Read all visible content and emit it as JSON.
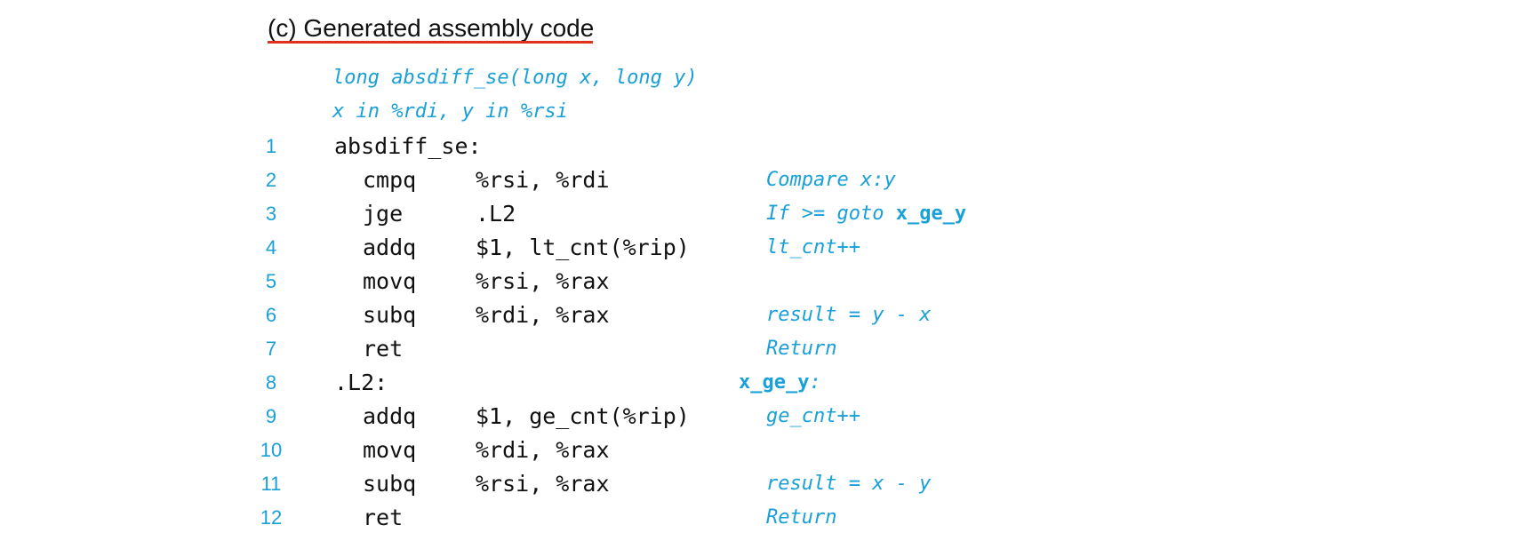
{
  "caption": "(c) Generated assembly code",
  "signature": {
    "line1": "long absdiff_se(long x, long y)",
    "line2": "x in %rdi, y in %rsi"
  },
  "colors": {
    "accent": "#1aa0d8",
    "underline": "#e0301e",
    "text": "#111111"
  },
  "lines": [
    {
      "num": "1",
      "label": "absdiff_se:",
      "op": "",
      "args": "",
      "comment": ""
    },
    {
      "num": "2",
      "label": "",
      "op": "cmpq",
      "args": "%rsi, %rdi",
      "comment": "Compare x:y"
    },
    {
      "num": "3",
      "label": "",
      "op": "jge",
      "args": ".L2",
      "comment": "If >= goto ",
      "comment_bold": "x_ge_y"
    },
    {
      "num": "4",
      "label": "",
      "op": "addq",
      "args": "$1, lt_cnt(%rip)",
      "comment": "lt_cnt++"
    },
    {
      "num": "5",
      "label": "",
      "op": "movq",
      "args": "%rsi, %rax",
      "comment": ""
    },
    {
      "num": "6",
      "label": "",
      "op": "subq",
      "args": "%rdi, %rax",
      "comment": "result = y - x"
    },
    {
      "num": "7",
      "label": "",
      "op": "ret",
      "args": "",
      "comment": "Return"
    },
    {
      "num": "8",
      "label": ".L2:",
      "op": "",
      "args": "",
      "comment_label": "x_ge_y",
      "comment_label_colon": ":"
    },
    {
      "num": "9",
      "label": "",
      "op": "addq",
      "args": "$1, ge_cnt(%rip)",
      "comment": "ge_cnt++"
    },
    {
      "num": "10",
      "label": "",
      "op": "movq",
      "args": "%rdi, %rax",
      "comment": ""
    },
    {
      "num": "11",
      "label": "",
      "op": "subq",
      "args": "%rsi, %rax",
      "comment": "result = x - y"
    },
    {
      "num": "12",
      "label": "",
      "op": "ret",
      "args": "",
      "comment": "Return"
    }
  ]
}
